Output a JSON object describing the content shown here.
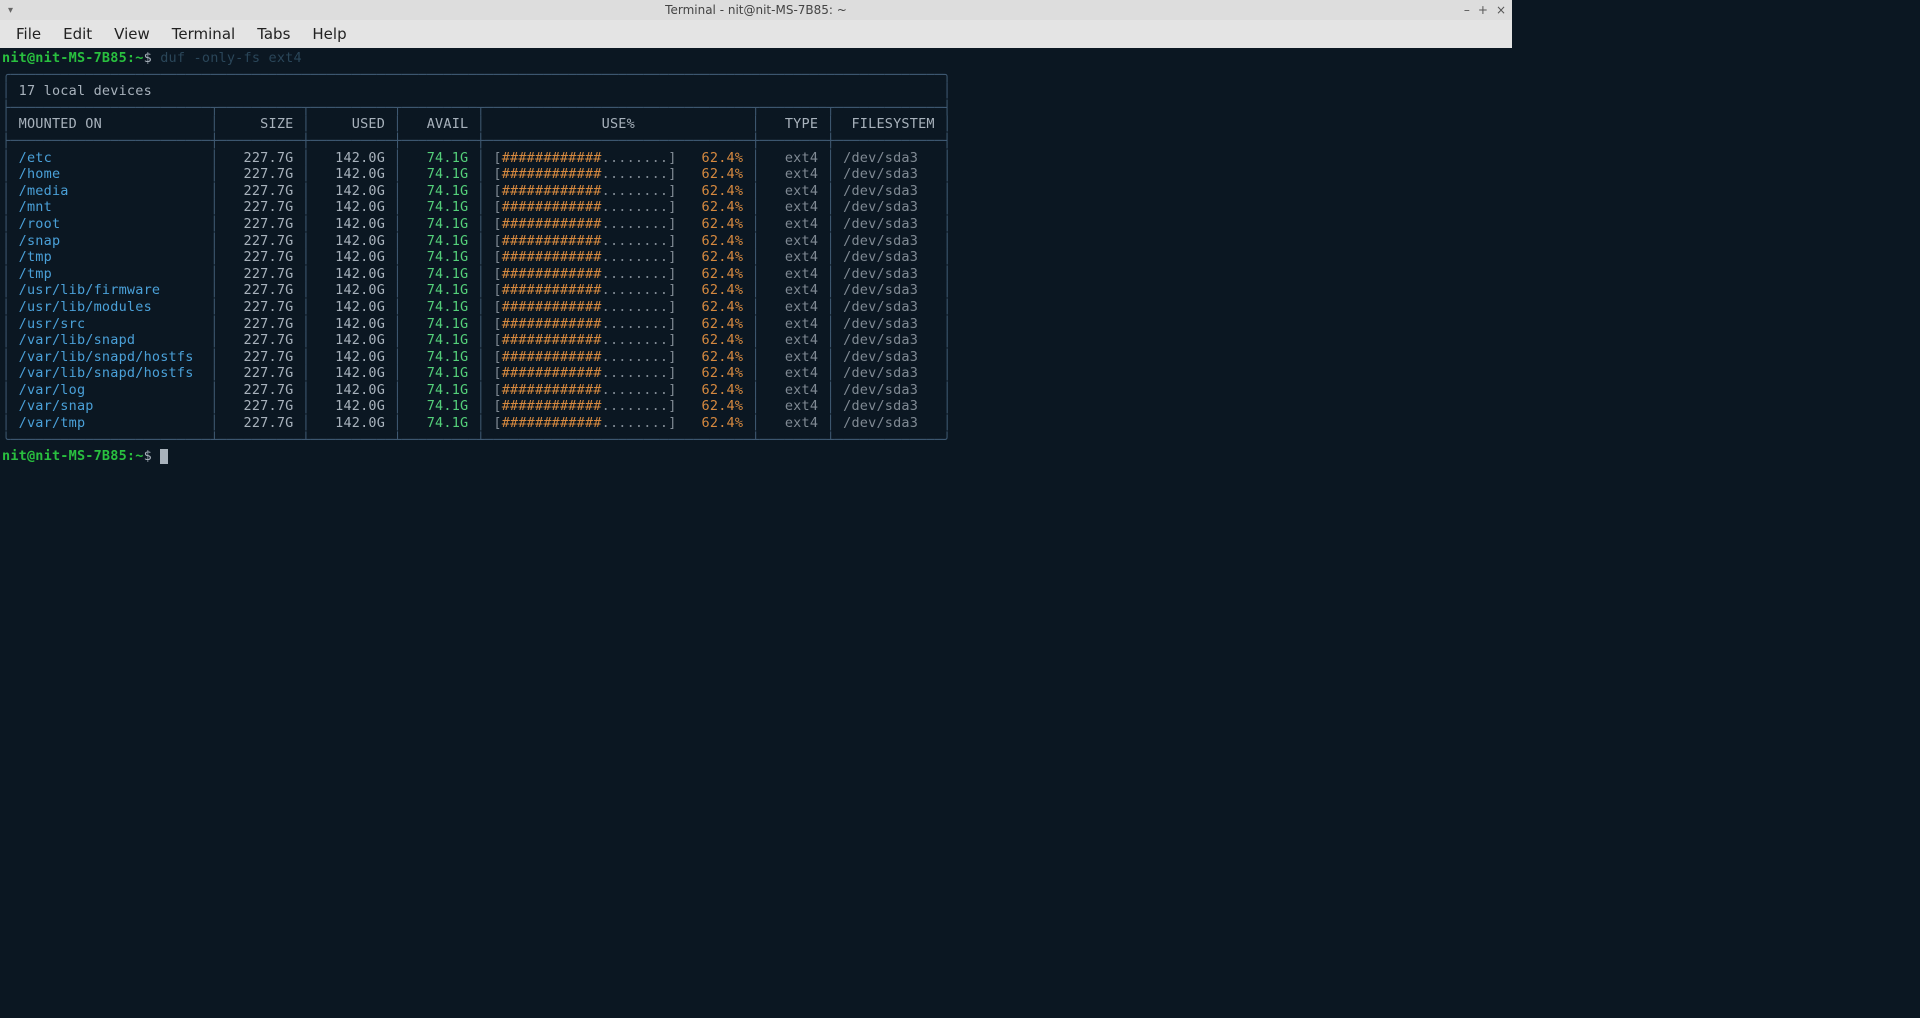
{
  "window": {
    "title": "Terminal - nit@nit-MS-7B85: ~",
    "buttons": {
      "min": "–",
      "max": "+",
      "close": "×"
    }
  },
  "menubar": [
    "File",
    "Edit",
    "View",
    "Terminal",
    "Tabs",
    "Help"
  ],
  "prompt": {
    "user_host": "nit@nit-MS-7B85",
    "sep": ":",
    "path": "~",
    "dollar": "$"
  },
  "command": "duf -only-fs ext4",
  "table": {
    "title": "17 local devices",
    "headers": {
      "mounted_on": "MOUNTED ON",
      "size": "SIZE",
      "used": "USED",
      "avail": "AVAIL",
      "use_pct": "USE%",
      "type": "TYPE",
      "filesystem": "FILESYSTEM"
    },
    "rows": [
      {
        "mount": "/etc",
        "size": "227.7G",
        "used": "142.0G",
        "avail": "74.1G",
        "bar_fill": 12,
        "bar_empty": 8,
        "pct": "62.4%",
        "type": "ext4",
        "fs": "/dev/sda3"
      },
      {
        "mount": "/home",
        "size": "227.7G",
        "used": "142.0G",
        "avail": "74.1G",
        "bar_fill": 12,
        "bar_empty": 8,
        "pct": "62.4%",
        "type": "ext4",
        "fs": "/dev/sda3"
      },
      {
        "mount": "/media",
        "size": "227.7G",
        "used": "142.0G",
        "avail": "74.1G",
        "bar_fill": 12,
        "bar_empty": 8,
        "pct": "62.4%",
        "type": "ext4",
        "fs": "/dev/sda3"
      },
      {
        "mount": "/mnt",
        "size": "227.7G",
        "used": "142.0G",
        "avail": "74.1G",
        "bar_fill": 12,
        "bar_empty": 8,
        "pct": "62.4%",
        "type": "ext4",
        "fs": "/dev/sda3"
      },
      {
        "mount": "/root",
        "size": "227.7G",
        "used": "142.0G",
        "avail": "74.1G",
        "bar_fill": 12,
        "bar_empty": 8,
        "pct": "62.4%",
        "type": "ext4",
        "fs": "/dev/sda3"
      },
      {
        "mount": "/snap",
        "size": "227.7G",
        "used": "142.0G",
        "avail": "74.1G",
        "bar_fill": 12,
        "bar_empty": 8,
        "pct": "62.4%",
        "type": "ext4",
        "fs": "/dev/sda3"
      },
      {
        "mount": "/tmp",
        "size": "227.7G",
        "used": "142.0G",
        "avail": "74.1G",
        "bar_fill": 12,
        "bar_empty": 8,
        "pct": "62.4%",
        "type": "ext4",
        "fs": "/dev/sda3"
      },
      {
        "mount": "/tmp",
        "size": "227.7G",
        "used": "142.0G",
        "avail": "74.1G",
        "bar_fill": 12,
        "bar_empty": 8,
        "pct": "62.4%",
        "type": "ext4",
        "fs": "/dev/sda3"
      },
      {
        "mount": "/usr/lib/firmware",
        "size": "227.7G",
        "used": "142.0G",
        "avail": "74.1G",
        "bar_fill": 12,
        "bar_empty": 8,
        "pct": "62.4%",
        "type": "ext4",
        "fs": "/dev/sda3"
      },
      {
        "mount": "/usr/lib/modules",
        "size": "227.7G",
        "used": "142.0G",
        "avail": "74.1G",
        "bar_fill": 12,
        "bar_empty": 8,
        "pct": "62.4%",
        "type": "ext4",
        "fs": "/dev/sda3"
      },
      {
        "mount": "/usr/src",
        "size": "227.7G",
        "used": "142.0G",
        "avail": "74.1G",
        "bar_fill": 12,
        "bar_empty": 8,
        "pct": "62.4%",
        "type": "ext4",
        "fs": "/dev/sda3"
      },
      {
        "mount": "/var/lib/snapd",
        "size": "227.7G",
        "used": "142.0G",
        "avail": "74.1G",
        "bar_fill": 12,
        "bar_empty": 8,
        "pct": "62.4%",
        "type": "ext4",
        "fs": "/dev/sda3"
      },
      {
        "mount": "/var/lib/snapd/hostfs",
        "size": "227.7G",
        "used": "142.0G",
        "avail": "74.1G",
        "bar_fill": 12,
        "bar_empty": 8,
        "pct": "62.4%",
        "type": "ext4",
        "fs": "/dev/sda3"
      },
      {
        "mount": "/var/lib/snapd/hostfs",
        "size": "227.7G",
        "used": "142.0G",
        "avail": "74.1G",
        "bar_fill": 12,
        "bar_empty": 8,
        "pct": "62.4%",
        "type": "ext4",
        "fs": "/dev/sda3"
      },
      {
        "mount": "/var/log",
        "size": "227.7G",
        "used": "142.0G",
        "avail": "74.1G",
        "bar_fill": 12,
        "bar_empty": 8,
        "pct": "62.4%",
        "type": "ext4",
        "fs": "/dev/sda3"
      },
      {
        "mount": "/var/snap",
        "size": "227.7G",
        "used": "142.0G",
        "avail": "74.1G",
        "bar_fill": 12,
        "bar_empty": 8,
        "pct": "62.4%",
        "type": "ext4",
        "fs": "/dev/sda3"
      },
      {
        "mount": "/var/tmp",
        "size": "227.7G",
        "used": "142.0G",
        "avail": "74.1G",
        "bar_fill": 12,
        "bar_empty": 8,
        "pct": "62.4%",
        "type": "ext4",
        "fs": "/dev/sda3"
      }
    ]
  },
  "col_widths": {
    "mount": 22,
    "size": 8,
    "used": 8,
    "avail": 7,
    "bar_area": 30,
    "type": 6,
    "fs": 11
  },
  "box_chars": {
    "tl": "╭",
    "tr": "╮",
    "bl": "╰",
    "br": "╯",
    "h": "─",
    "v": "│",
    "tj": "┬",
    "bj": "┴",
    "lj": "├",
    "rj": "┤",
    "cj": "┼"
  }
}
